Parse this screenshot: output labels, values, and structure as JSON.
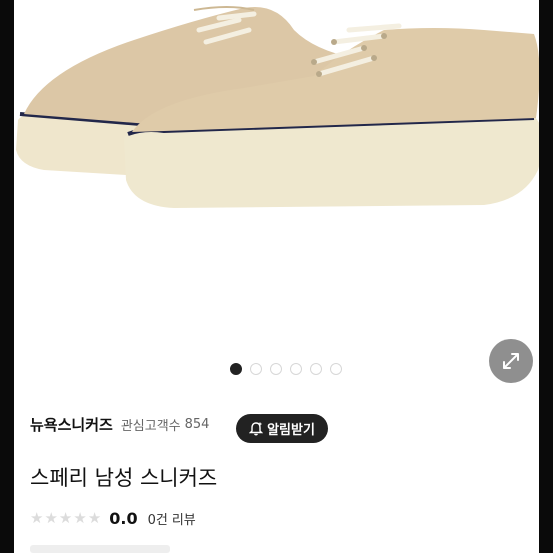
{
  "product": {
    "store_name": "뉴욕스니커즈",
    "follower_label": "관심고객수",
    "follower_count": "854",
    "follow_button_label": "알림받기",
    "title": "스페리 남성 스니커즈",
    "rating_value": "0.0",
    "review_count": "0건",
    "review_label": "리뷰",
    "rating_stars": 0
  },
  "gallery": {
    "total_images": 6,
    "active_index": 0
  },
  "icons": {
    "expand": "expand-arrows-icon",
    "bell": "bell-plus-icon",
    "star": "star-icon"
  },
  "colors": {
    "follow_button_bg": "#222222",
    "expand_button_bg": "#8f8f8f",
    "star_empty": "#dcdcdc",
    "active_dot": "#222222"
  }
}
